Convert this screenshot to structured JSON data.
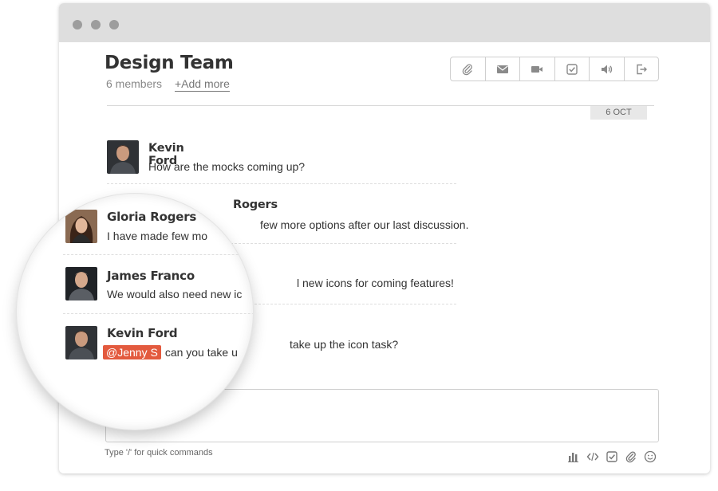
{
  "group": {
    "title": "Design Team",
    "members": "6 members",
    "add_more": "+Add more"
  },
  "date_label": "6 OCT",
  "toolbar": {
    "icons": [
      "paperclip-icon",
      "mail-icon",
      "video-icon",
      "checkbox-icon",
      "speaker-icon",
      "exit-icon"
    ]
  },
  "messages": [
    {
      "name": "Kevin Ford",
      "text": "How are the mocks coming up?"
    },
    {
      "name": "Gloria Rogers",
      "text": "I have made few more options after our last discussion.",
      "partial_name": "Rogers",
      "partial_text": "few more options after our last discussion."
    },
    {
      "name": "James Franco",
      "text": "We would also need new icons for coming features!",
      "partial_text": "l new icons for coming features!"
    },
    {
      "name": "Kevin Ford",
      "mention": "@Jenny S",
      "text": "can you take up the icon task?",
      "partial_text": "take up the icon task?"
    }
  ],
  "magnifier": {
    "rows": [
      {
        "name": "Gloria Rogers",
        "text": "I have made few mo"
      },
      {
        "name": "James Franco",
        "text": "We would also need new ic"
      },
      {
        "name": "Kevin Ford",
        "mention": "@Jenny S",
        "text": "can you take u"
      }
    ]
  },
  "composer": {
    "hint": "Type '/' for quick commands",
    "icons": [
      "chart-icon",
      "code-icon",
      "checkbox-icon",
      "paperclip-icon",
      "smiley-icon"
    ]
  },
  "colors": {
    "mention_bg": "#e35a3e",
    "titlebar": "#dedede"
  }
}
